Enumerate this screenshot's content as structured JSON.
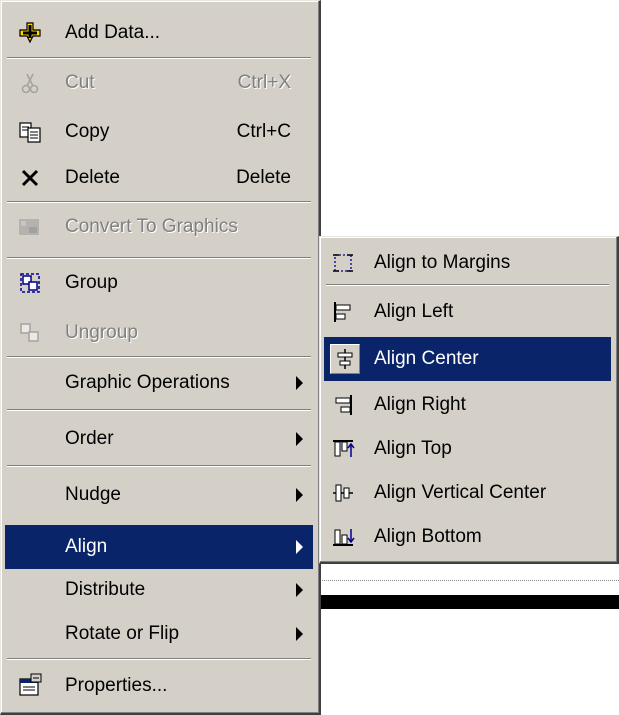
{
  "main_menu": {
    "items": [
      {
        "label": "Add Data...",
        "icon": "add-data-icon",
        "enabled": true
      },
      {
        "label": "Cut",
        "shortcut": "Ctrl+X",
        "icon": "scissors-icon",
        "enabled": false
      },
      {
        "label": "Copy",
        "shortcut": "Ctrl+C",
        "icon": "copy-icon",
        "enabled": true
      },
      {
        "label": "Delete",
        "shortcut": "Delete",
        "icon": "delete-x-icon",
        "enabled": true
      },
      {
        "label": "Convert To Graphics",
        "icon": "convert-graphics-icon",
        "enabled": false
      },
      {
        "label": "Group",
        "icon": "group-icon",
        "enabled": true
      },
      {
        "label": "Ungroup",
        "icon": "ungroup-icon",
        "enabled": false
      },
      {
        "label": "Graphic Operations",
        "submenu": true,
        "enabled": true
      },
      {
        "label": "Order",
        "submenu": true,
        "enabled": true
      },
      {
        "label": "Nudge",
        "submenu": true,
        "enabled": true
      },
      {
        "label": "Align",
        "submenu": true,
        "enabled": true,
        "highlighted": true
      },
      {
        "label": "Distribute",
        "submenu": true,
        "enabled": true
      },
      {
        "label": "Rotate or Flip",
        "submenu": true,
        "enabled": true
      },
      {
        "label": "Properties...",
        "icon": "properties-icon",
        "enabled": true
      }
    ]
  },
  "align_submenu": {
    "items": [
      {
        "label": "Align to Margins",
        "icon": "align-margins-icon"
      },
      {
        "label": "Align Left",
        "icon": "align-left-icon"
      },
      {
        "label": "Align Center",
        "icon": "align-center-icon",
        "highlighted": true
      },
      {
        "label": "Align Right",
        "icon": "align-right-icon"
      },
      {
        "label": "Align Top",
        "icon": "align-top-icon"
      },
      {
        "label": "Align Vertical Center",
        "icon": "align-vertical-center-icon"
      },
      {
        "label": "Align Bottom",
        "icon": "align-bottom-icon"
      }
    ]
  },
  "colors": {
    "menu_bg": "#d4d0c8",
    "highlight": "#0a246a",
    "disabled_text": "#808080"
  }
}
